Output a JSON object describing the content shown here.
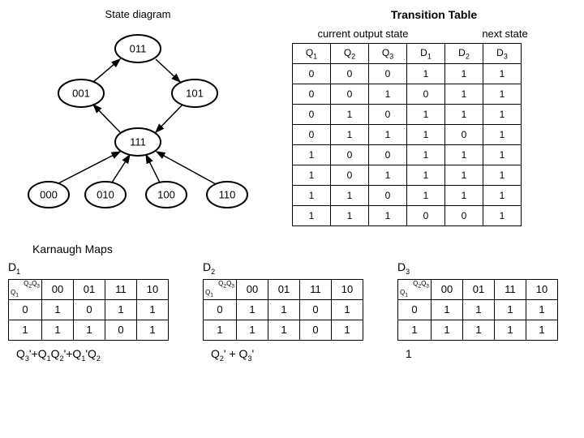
{
  "titles": {
    "state_diagram": "State diagram",
    "transition_table": "Transition Table",
    "current_output_state": "current output state",
    "next_state": "next state",
    "karnaugh_maps": "Karnaugh Maps"
  },
  "state_diagram": {
    "nodes": [
      "011",
      "001",
      "101",
      "111",
      "000",
      "010",
      "100",
      "110"
    ]
  },
  "transition_table": {
    "headers": [
      "Q1",
      "Q2",
      "Q3",
      "D1",
      "D2",
      "D3"
    ],
    "rows": [
      [
        "0",
        "0",
        "0",
        "1",
        "1",
        "1"
      ],
      [
        "0",
        "0",
        "1",
        "0",
        "1",
        "1"
      ],
      [
        "0",
        "1",
        "0",
        "1",
        "1",
        "1"
      ],
      [
        "0",
        "1",
        "1",
        "1",
        "0",
        "1"
      ],
      [
        "1",
        "0",
        "0",
        "1",
        "1",
        "1"
      ],
      [
        "1",
        "0",
        "1",
        "1",
        "1",
        "1"
      ],
      [
        "1",
        "1",
        "0",
        "1",
        "1",
        "1"
      ],
      [
        "1",
        "1",
        "1",
        "0",
        "0",
        "1"
      ]
    ]
  },
  "kmaps": [
    {
      "label": "D1",
      "col_headers": [
        "00",
        "01",
        "11",
        "10"
      ],
      "row_headers": [
        "0",
        "1"
      ],
      "cells": [
        [
          "1",
          "0",
          "1",
          "1"
        ],
        [
          "1",
          "1",
          "0",
          "1"
        ]
      ],
      "expr": "Q3'+Q1Q2'+Q1'Q2"
    },
    {
      "label": "D2",
      "col_headers": [
        "00",
        "01",
        "11",
        "10"
      ],
      "row_headers": [
        "0",
        "1"
      ],
      "cells": [
        [
          "1",
          "1",
          "0",
          "1"
        ],
        [
          "1",
          "1",
          "0",
          "1"
        ]
      ],
      "expr": "Q2' + Q3'"
    },
    {
      "label": "D3",
      "col_headers": [
        "00",
        "01",
        "11",
        "10"
      ],
      "row_headers": [
        "0",
        "1"
      ],
      "cells": [
        [
          "1",
          "1",
          "1",
          "1"
        ],
        [
          "1",
          "1",
          "1",
          "1"
        ]
      ],
      "expr": "1"
    }
  ],
  "chart_data": {
    "type": "table",
    "title": "Transition Table and Karnaugh Maps for 3-bit state machine",
    "transition_table": {
      "inputs": [
        "Q1",
        "Q2",
        "Q3"
      ],
      "outputs": [
        "D1",
        "D2",
        "D3"
      ],
      "rows": [
        {
          "Q1": 0,
          "Q2": 0,
          "Q3": 0,
          "D1": 1,
          "D2": 1,
          "D3": 1
        },
        {
          "Q1": 0,
          "Q2": 0,
          "Q3": 1,
          "D1": 0,
          "D2": 1,
          "D3": 1
        },
        {
          "Q1": 0,
          "Q2": 1,
          "Q3": 0,
          "D1": 1,
          "D2": 1,
          "D3": 1
        },
        {
          "Q1": 0,
          "Q2": 1,
          "Q3": 1,
          "D1": 1,
          "D2": 0,
          "D3": 1
        },
        {
          "Q1": 1,
          "Q2": 0,
          "Q3": 0,
          "D1": 1,
          "D2": 1,
          "D3": 1
        },
        {
          "Q1": 1,
          "Q2": 0,
          "Q3": 1,
          "D1": 1,
          "D2": 1,
          "D3": 1
        },
        {
          "Q1": 1,
          "Q2": 1,
          "Q3": 0,
          "D1": 1,
          "D2": 1,
          "D3": 1
        },
        {
          "Q1": 1,
          "Q2": 1,
          "Q3": 1,
          "D1": 0,
          "D2": 0,
          "D3": 1
        }
      ]
    },
    "state_transitions": [
      {
        "from": "000",
        "to": "111"
      },
      {
        "from": "001",
        "to": "011"
      },
      {
        "from": "010",
        "to": "111"
      },
      {
        "from": "011",
        "to": "101"
      },
      {
        "from": "100",
        "to": "111"
      },
      {
        "from": "101",
        "to": "111"
      },
      {
        "from": "110",
        "to": "111"
      },
      {
        "from": "111",
        "to": "001"
      }
    ],
    "expressions": {
      "D1": "Q3' + Q1 Q2' + Q1' Q2",
      "D2": "Q2' + Q3'",
      "D3": "1"
    }
  }
}
